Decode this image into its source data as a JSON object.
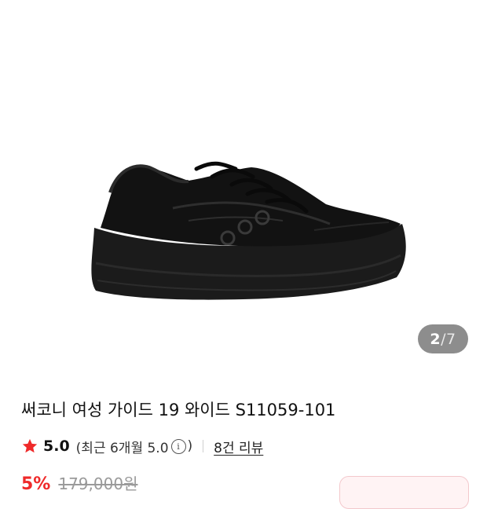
{
  "gallery": {
    "image_alt": "black running shoe",
    "indicator": {
      "current": "2",
      "separator": "/",
      "total": "7"
    }
  },
  "product": {
    "title": "써코니 여성 가이드 19 와이드 S11059-101",
    "rating": {
      "score": "5.0",
      "recent_prefix": "(최근 6개월 5.0",
      "recent_suffix": ")",
      "info_icon": "i",
      "reviews_link": "8건 리뷰"
    },
    "price": {
      "discount": "5%",
      "original": "179,000원"
    }
  },
  "colors": {
    "star": "#ef2a2a",
    "discount": "#ef2a2a",
    "indicator_bg": "#8d8d8d"
  }
}
